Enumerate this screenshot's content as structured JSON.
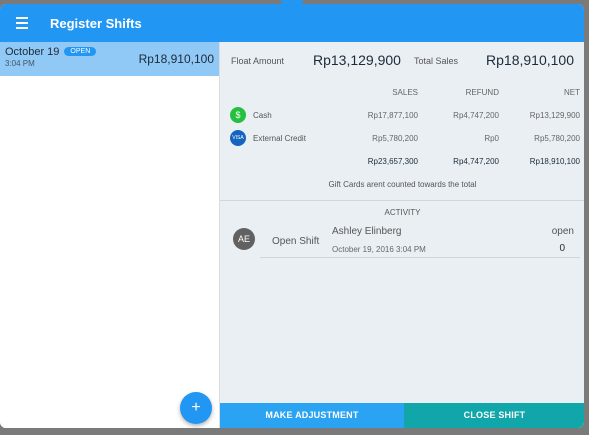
{
  "header": {
    "title": "Register Shifts"
  },
  "shift_list": [
    {
      "date": "October 19",
      "status": "OPEN",
      "time": "3:04 PM",
      "amount": "Rp18,910,100"
    }
  ],
  "summary": {
    "float_label": "Float Amount",
    "float_value": "Rp13,129,900",
    "sales_label": "Total Sales",
    "sales_value": "Rp18,910,100"
  },
  "payments": {
    "columns": [
      "SALES",
      "REFUND",
      "NET"
    ],
    "rows": [
      {
        "label": "Cash",
        "icon": "dollar-icon",
        "sales": "Rp17,877,100",
        "refund": "Rp4,747,200",
        "net": "Rp13,129,900"
      },
      {
        "label": "External Credit",
        "icon": "visa-icon",
        "sales": "Rp5,780,200",
        "refund": "Rp0",
        "net": "Rp5,780,200"
      }
    ],
    "totals": {
      "sales": "Rp23,657,300",
      "refund": "Rp4,747,200",
      "net": "Rp18,910,100"
    },
    "note": "Gift Cards arent counted towards the total"
  },
  "activity": {
    "heading": "ACTIVITY",
    "entries": [
      {
        "avatar": "AE",
        "type": "Open Shift",
        "user": "Ashley Elinberg",
        "state": "open",
        "date": "October 19, 2016  3:04 PM",
        "amount": "0"
      }
    ]
  },
  "actions": {
    "adjust": "MAKE ADJUSTMENT",
    "close": "CLOSE SHIFT",
    "add": "+"
  },
  "close_bubble": "×",
  "colors": {
    "primary": "#2196f3",
    "teal": "#10a6aa",
    "cash_icon": "#25c040",
    "visa_icon": "#1565c0"
  }
}
